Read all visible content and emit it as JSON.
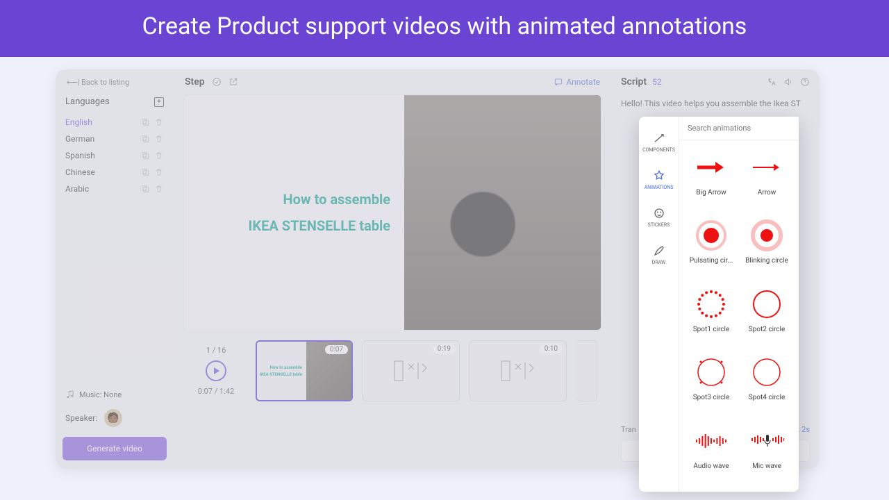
{
  "banner": {
    "title": "Create Product support videos with animated annotations"
  },
  "left": {
    "back": "⟵| Back to listing",
    "languages_label": "Languages",
    "languages": [
      {
        "name": "English",
        "active": true
      },
      {
        "name": "German",
        "active": false
      },
      {
        "name": "Spanish",
        "active": false
      },
      {
        "name": "Chinese",
        "active": false
      },
      {
        "name": "Arabic",
        "active": false
      }
    ],
    "music_label": "Music: None",
    "speaker_label": "Speaker:",
    "generate_label": "Generate video"
  },
  "center": {
    "step_label": "Step",
    "annotate_label": "Annotate",
    "canvas": {
      "line1": "How to assemble",
      "line2": "IKEA STENSELLE table"
    },
    "tl_counter": "1 / 16",
    "tl_time": "0:07 / 1:42",
    "thumbs": [
      {
        "time": "0:07",
        "type": "cover"
      },
      {
        "time": "0:19",
        "type": "diagram"
      },
      {
        "time": "0:10",
        "type": "diagram"
      }
    ]
  },
  "right": {
    "script_label": "Script",
    "script_count": "52",
    "script_text": "Hello! This video helps you assemble the Ikea ST",
    "transition_label": "Tran",
    "transition_secs": "2s"
  },
  "panel": {
    "search_placeholder": "Search animations",
    "tabs": [
      {
        "id": "components",
        "label": "COMPONENTS"
      },
      {
        "id": "animations",
        "label": "ANIMATIONS",
        "active": true
      },
      {
        "id": "stickers",
        "label": "STICKERS"
      },
      {
        "id": "draw",
        "label": "DRAW"
      }
    ],
    "items": [
      {
        "id": "big-arrow",
        "label": "Big Arrow"
      },
      {
        "id": "arrow",
        "label": "Arrow"
      },
      {
        "id": "pulsating-circle",
        "label": "Pulsating cir..."
      },
      {
        "id": "blinking-circle",
        "label": "Blinking circle"
      },
      {
        "id": "spot1-circle",
        "label": "Spot1 circle"
      },
      {
        "id": "spot2-circle",
        "label": "Spot2 circle"
      },
      {
        "id": "spot3-circle",
        "label": "Spot3 circle"
      },
      {
        "id": "spot4-circle",
        "label": "Spot4 circle"
      },
      {
        "id": "audio-wave",
        "label": "Audio wave"
      },
      {
        "id": "mic-wave",
        "label": "Mic wave"
      }
    ]
  }
}
